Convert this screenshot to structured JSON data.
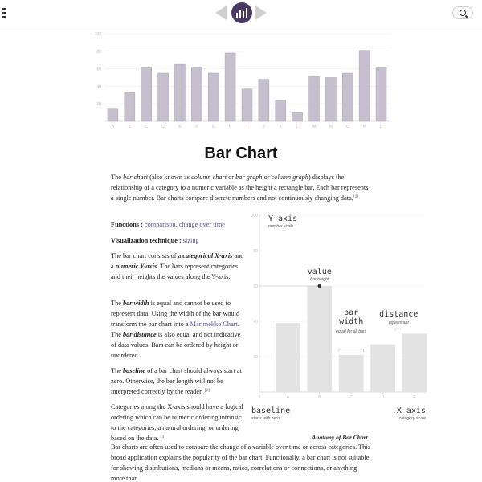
{
  "header": {
    "logo_icon": "bar-chart-logo-icon",
    "menu_icon": "menu-icon",
    "search_icon": "search-icon"
  },
  "hero_chart": {
    "type": "bar",
    "categories": [
      "A",
      "B",
      "C",
      "D",
      "E",
      "F",
      "G",
      "H",
      "I",
      "J",
      "K",
      "L",
      "M",
      "N",
      "O",
      "P",
      "Q"
    ],
    "values": [
      14,
      33,
      61,
      55,
      65,
      61,
      55,
      78,
      37,
      48,
      24,
      10,
      51,
      50,
      55,
      81,
      61
    ],
    "yticks": [
      "20",
      "40",
      "60",
      "80",
      "100"
    ],
    "ylim": [
      0,
      100
    ],
    "bar_color": "#c6bfcd",
    "grid": true
  },
  "page": {
    "title": "Bar Chart"
  },
  "intro": {
    "p1": {
      "t1": "The ",
      "e1": "bar chart",
      "t2": " (also known as ",
      "e2": "column chart",
      "t3": " or ",
      "e3": "bar graph",
      "t4": " or ",
      "e4": "column graph",
      "t5": ") displays the relationship of a category to a numeric variable as the height a rectangle bar. Each bar represents a single number. Bar charts compare discrete numbers and not continuously changing data.",
      "ref": "[1]"
    },
    "functions_label": "Functions :",
    "functions_link1": "comparison",
    "functions_sep": ", ",
    "functions_link2": "change over time",
    "technique_label": "Visualization technique :",
    "technique_link": "sizing",
    "p2": {
      "t1": "The bar chart consists of a ",
      "b1": "categorical X-axis",
      "t2": " and a ",
      "b2": "numeric Y-axis",
      "t3": ". The bars represent categories and their heights the values along the Y-axis."
    },
    "p3": {
      "t1": "The ",
      "b1": "bar width",
      "t2": " is equal and cannot be used to represent data. Using the width of the bar would transform the bar chart into a ",
      "link": "Marimekko Chart",
      "t3": ". The ",
      "b2": "bar distance",
      "t4": " is also equal and not indicative of data values. Bars can be ordered by height or unordered."
    },
    "p4": {
      "t1": "The ",
      "b1": "baseline",
      "t2": " of a bar chart should always start at zero. Otherwise, the bar length will not be interpreted correctly by the reader.",
      "ref": "[2]"
    },
    "p5": {
      "t1": "Categories along the X-axis should have a logical ordering which can be numeric ordering intrinsic to the categories, a natural ordering, or ordering based on the data.",
      "ref": "[3]"
    },
    "p6": {
      "t1": "Bar charts are often used to compare the change of a variable over time or across categories. This broad application explains the popularity of the bar chart. Functionally, a bar chart is not suitable for showing distributions, medians or means, ratios, correlations or connections, or anything more than"
    }
  },
  "anatomy_chart": {
    "type": "bar",
    "categories": [
      "A",
      "B",
      "C",
      "D",
      "E"
    ],
    "values": [
      39,
      60,
      21,
      27,
      33
    ],
    "yticks": [
      "20",
      "40",
      "60",
      "80",
      "100"
    ],
    "ylim": [
      0,
      100
    ],
    "bar_color": "#e3e3e3",
    "labels": {
      "yaxis": "Y axis",
      "yaxis_sub": "number scale",
      "value": "value",
      "value_sub": "bar height",
      "width": "bar\nwidth",
      "width_sub": "equal for all bars",
      "distance": "distance",
      "distance_sub": "equidistant",
      "baseline": "baseline",
      "baseline_sub": "starts with zero",
      "xaxis": "X axis",
      "xaxis_sub": "category scale"
    },
    "caption": "Anatomy of Bar Chart"
  }
}
